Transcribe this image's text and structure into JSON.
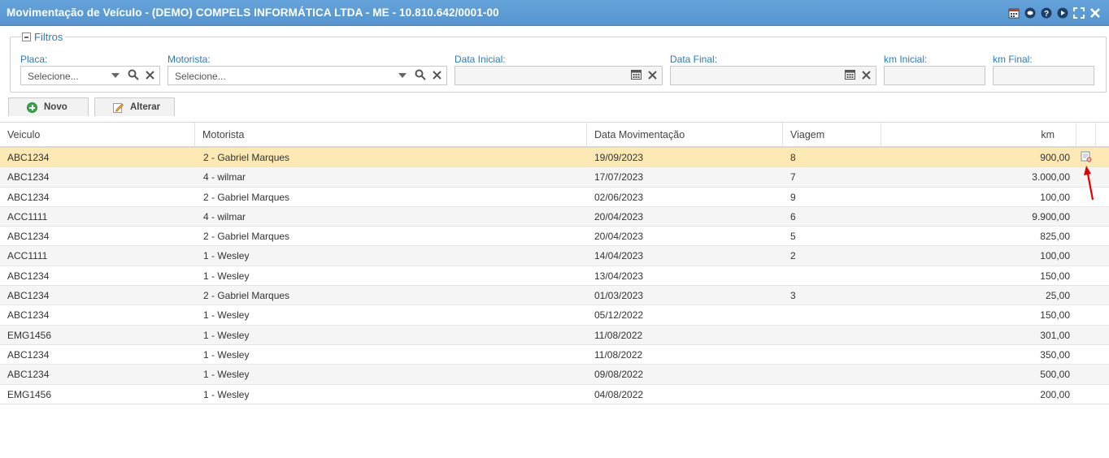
{
  "window": {
    "title": "Movimentação de Veículo - (DEMO) COMPELS INFORMÁTICA LTDA - ME - 10.810.642/0001-00",
    "icons": [
      "calendar-icon",
      "chat-icon",
      "help-icon",
      "play-icon",
      "maximize-icon",
      "close-icon"
    ]
  },
  "filters": {
    "legend": "Filtros",
    "placa_label": "Placa:",
    "placa_placeholder": "Selecione...",
    "motorista_label": "Motorista:",
    "motorista_placeholder": "Selecione...",
    "data_inicial_label": "Data Inicial:",
    "data_final_label": "Data Final:",
    "km_inicial_label": "km Inicial:",
    "km_final_label": "km Final:"
  },
  "toolbar": {
    "novo_label": "Novo",
    "alterar_label": "Alterar"
  },
  "table": {
    "headers": [
      "Veiculo",
      "Motorista",
      "Data Movimentação",
      "Viagem",
      "km"
    ],
    "rows": [
      {
        "veiculo": "ABC1234",
        "motorista": "2 - Gabriel Marques",
        "data": "19/09/2023",
        "viagem": "8",
        "km": "900,00"
      },
      {
        "veiculo": "ABC1234",
        "motorista": "4 - wilmar",
        "data": "17/07/2023",
        "viagem": "7",
        "km": "3.000,00"
      },
      {
        "veiculo": "ABC1234",
        "motorista": "2 - Gabriel Marques",
        "data": "02/06/2023",
        "viagem": "9",
        "km": "100,00"
      },
      {
        "veiculo": "ACC1111",
        "motorista": "4 - wilmar",
        "data": "20/04/2023",
        "viagem": "6",
        "km": "9.900,00"
      },
      {
        "veiculo": "ABC1234",
        "motorista": "2 - Gabriel Marques",
        "data": "20/04/2023",
        "viagem": "5",
        "km": "825,00"
      },
      {
        "veiculo": "ACC1111",
        "motorista": "1 - Wesley",
        "data": "14/04/2023",
        "viagem": "2",
        "km": "100,00"
      },
      {
        "veiculo": "ABC1234",
        "motorista": "1 - Wesley",
        "data": "13/04/2023",
        "viagem": "",
        "km": "150,00"
      },
      {
        "veiculo": "ABC1234",
        "motorista": "2 - Gabriel Marques",
        "data": "01/03/2023",
        "viagem": "3",
        "km": "25,00"
      },
      {
        "veiculo": "ABC1234",
        "motorista": "1 - Wesley",
        "data": "05/12/2022",
        "viagem": "",
        "km": "150,00"
      },
      {
        "veiculo": "EMG1456",
        "motorista": "1 - Wesley",
        "data": "11/08/2022",
        "viagem": "",
        "km": "301,00"
      },
      {
        "veiculo": "ABC1234",
        "motorista": "1 - Wesley",
        "data": "11/08/2022",
        "viagem": "",
        "km": "350,00"
      },
      {
        "veiculo": "ABC1234",
        "motorista": "1 - Wesley",
        "data": "09/08/2022",
        "viagem": "",
        "km": "500,00"
      },
      {
        "veiculo": "EMG1456",
        "motorista": "1 - Wesley",
        "data": "04/08/2022",
        "viagem": "",
        "km": "200,00"
      }
    ],
    "selected_row": 0
  },
  "colors": {
    "titlebar": "#5b9bd5",
    "label": "#2a7ac0",
    "selected_row": "#fde9b4",
    "annotation_arrow": "#e00000"
  }
}
